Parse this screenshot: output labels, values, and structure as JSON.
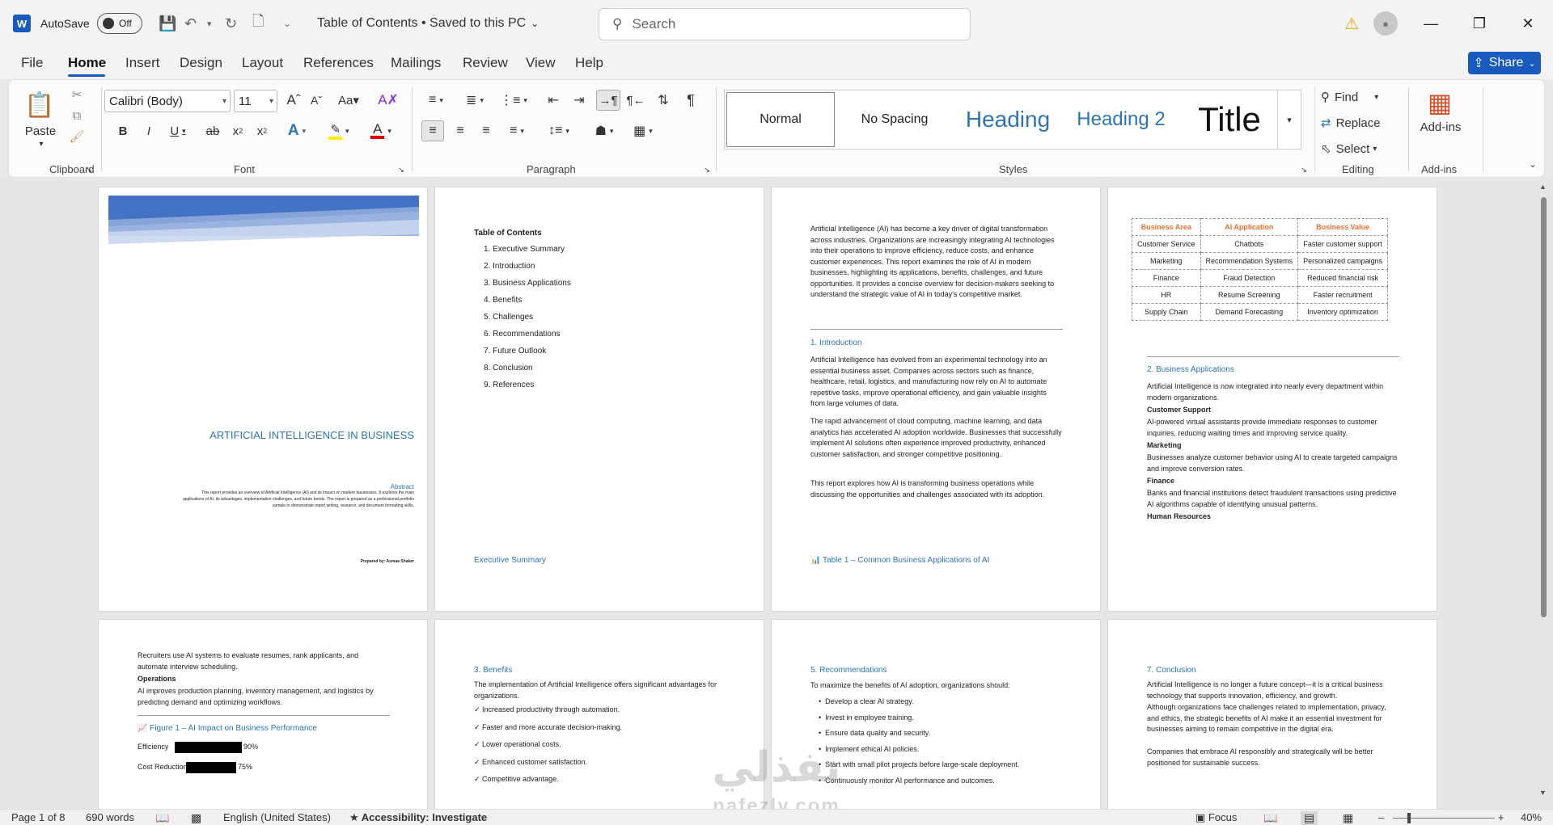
{
  "titlebar": {
    "autosave_label": "AutoSave",
    "autosave_state": "Off",
    "document_title": "Table of Contents • Saved to this PC",
    "search_placeholder": "Search"
  },
  "tabs": [
    "File",
    "Home",
    "Insert",
    "Design",
    "Layout",
    "References",
    "Mailings",
    "Review",
    "View",
    "Help"
  ],
  "share_label": "Share",
  "ribbon": {
    "clipboard": {
      "paste": "Paste",
      "label": "Clipboard"
    },
    "font": {
      "name": "Calibri (Body)",
      "size": "11",
      "label": "Font"
    },
    "paragraph_label": "Paragraph",
    "styles": {
      "items": [
        "Normal",
        "No Spacing",
        "Heading",
        "Heading 2",
        "Title"
      ],
      "label": "Styles"
    },
    "editing": {
      "find": "Find",
      "replace": "Replace",
      "select": "Select",
      "label": "Editing"
    },
    "addins": {
      "button": "Add-ins",
      "label": "Add-ins"
    }
  },
  "page1": {
    "title": "ARTIFICIAL INTELLIGENCE IN BUSINESS",
    "abstract_heading": "Abstract",
    "abstract_text": "This report provides an overview of Artificial Intelligence (AI) and its impact on modern businesses. It explores the main applications of AI, its advantages, implementation challenges, and future trends. The report is prepared as a professional portfolio sample to demonstrate report writing, research, and document formatting skills.",
    "prepared_by": "Prepared by: Asmaa Shaker"
  },
  "page2": {
    "toc_heading": "Table of Contents",
    "toc_items": [
      "Executive Summary",
      "Introduction",
      "Business Applications",
      "Benefits",
      "Challenges",
      "Recommendations",
      "Future Outlook",
      "Conclusion",
      "References"
    ],
    "footer_heading": "Executive Summary"
  },
  "page3": {
    "para1": "Artificial Intelligence (AI) has become a key driver of digital transformation across industries. Organizations are increasingly integrating AI technologies into their operations to improve efficiency, reduce costs, and enhance customer experiences. This report examines the role of AI in modern businesses, highlighting its applications, benefits, challenges, and future opportunities. It provides a concise overview for decision-makers seeking to understand the strategic value of AI in today's competitive market.",
    "intro_heading": "1. Introduction",
    "intro_p1": "Artificial Intelligence has evolved from an experimental technology into an essential business asset. Companies across sectors such as finance, healthcare, retail, logistics, and manufacturing now rely on AI to automate repetitive tasks, improve operational efficiency, and gain valuable insights from large volumes of data.",
    "intro_p2": "The rapid advancement of cloud computing, machine learning, and data analytics has accelerated AI adoption worldwide. Businesses that successfully implement AI solutions often experience improved productivity, enhanced customer satisfaction, and stronger competitive positioning.",
    "intro_p3": "This report explores how AI is transforming business operations while discussing the opportunities and challenges associated with its adoption.",
    "table_caption": "📊 Table 1 – Common Business Applications of AI"
  },
  "page4": {
    "table_headers": [
      "Business Area",
      "AI Application",
      "Business Value"
    ],
    "table_rows": [
      [
        "Customer Service",
        "Chatbots",
        "Faster customer support"
      ],
      [
        "Marketing",
        "Recommendation Systems",
        "Personalized campaigns"
      ],
      [
        "Finance",
        "Fraud Detection",
        "Reduced financial risk"
      ],
      [
        "HR",
        "Resume Screening",
        "Faster recruitment"
      ],
      [
        "Supply Chain",
        "Demand Forecasting",
        "Inventory optimization"
      ]
    ],
    "section_heading": "2. Business Applications",
    "section_intro": "Artificial Intelligence is now integrated into nearly every department within modern organizations.",
    "cs_heading": "Customer Support",
    "cs_text": "AI-powered virtual assistants provide immediate responses to customer inquiries, reducing waiting times and improving service quality.",
    "mk_heading": "Marketing",
    "mk_text": "Businesses analyze customer behavior using AI to create targeted campaigns and improve conversion rates.",
    "fin_heading": "Finance",
    "fin_text": "Banks and financial institutions detect fraudulent transactions using predictive AI algorithms capable of identifying unusual patterns.",
    "hr_heading": "Human Resources"
  },
  "page5": {
    "hr_text": "Recruiters use AI systems to evaluate resumes, rank applicants, and automate interview scheduling.",
    "ops_heading": "Operations",
    "ops_text": "AI improves production planning, inventory management, and logistics by predicting demand and optimizing workflows.",
    "figure_caption": "📈 Figure 1 – AI Impact on Business Performance",
    "bars": [
      {
        "label": "Efficiency",
        "value": 90,
        "display": "90%"
      },
      {
        "label": "Cost Reduction",
        "value": 75,
        "display": "75%"
      }
    ]
  },
  "page6": {
    "heading": "3. Benefits",
    "intro": "The implementation of Artificial Intelligence offers significant advantages for organizations.",
    "items": [
      "✓ Increased productivity through automation.",
      "✓ Faster and more accurate decision-making.",
      "✓ Lower operational costs.",
      "✓ Enhanced customer satisfaction.",
      "✓ Competitive advantage."
    ]
  },
  "page7": {
    "heading": "5. Recommendations",
    "intro": "To maximize the benefits of AI adoption, organizations should:",
    "items": [
      "Develop a clear AI strategy.",
      "Invest in employee training.",
      "Ensure data quality and security.",
      "Implement ethical AI policies.",
      "Start with small pilot projects before large-scale deployment.",
      "Continuously monitor AI performance and outcomes."
    ]
  },
  "page8": {
    "heading": "7. Conclusion",
    "p1": "Artificial Intelligence is no longer a future concept—it is a critical business technology that supports innovation, efficiency, and growth.",
    "p2": "Although organizations face challenges related to implementation, privacy, and ethics, the strategic benefits of AI make it an essential investment for businesses aiming to remain competitive in the digital era.",
    "p3": "Companies that embrace AI responsibly and strategically will be better positioned for sustainable success."
  },
  "statusbar": {
    "page": "Page 1 of 8",
    "words": "690 words",
    "language": "English (United States)",
    "accessibility": "Accessibility: Investigate",
    "focus": "Focus",
    "zoom": "40%"
  },
  "watermark": {
    "arabic": "نفذلي",
    "latin": "nafezly.com"
  },
  "colors": {
    "accent": "#185abd",
    "heading_blue": "#2e74b5",
    "table_orange": "#e97132"
  }
}
